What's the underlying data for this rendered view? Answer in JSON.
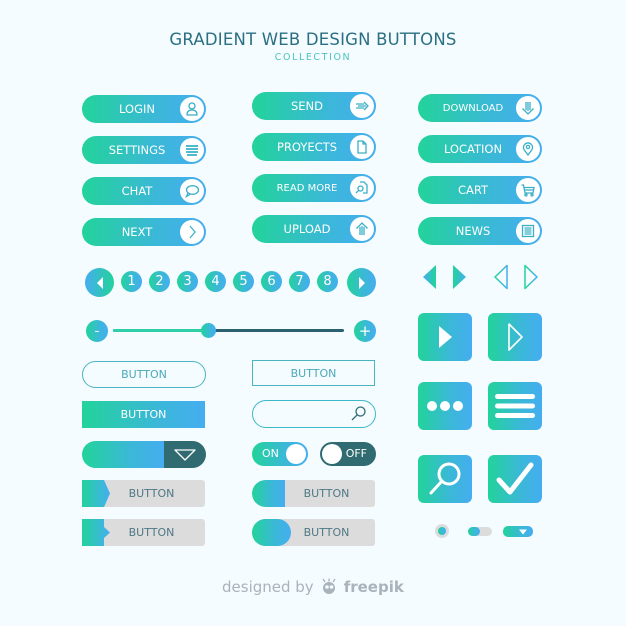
{
  "header": {
    "title": "GRADIENT WEB DESIGN BUTTONS",
    "subtitle": "COLLECTION"
  },
  "colors": {
    "background": "#f5fcff",
    "gradient_start": "#22d39a",
    "gradient_end": "#45adf0",
    "dark_teal": "#2f6b70",
    "title": "#2a6f82",
    "grey_button": "#dcdcdc"
  },
  "icon_buttons": [
    {
      "label": "LOGIN",
      "icon": "user-icon"
    },
    {
      "label": "SETTINGS",
      "icon": "menu-icon"
    },
    {
      "label": "CHAT",
      "icon": "chat-bubble-icon"
    },
    {
      "label": "NEXT",
      "icon": "chevron-right-icon"
    },
    {
      "label": "SEND",
      "icon": "send-arrow-icon"
    },
    {
      "label": "PROYECTS",
      "icon": "document-icon"
    },
    {
      "label": "READ MORE",
      "icon": "document-search-icon"
    },
    {
      "label": "UPLOAD",
      "icon": "upload-arrow-icon"
    },
    {
      "label": "DOWNLOAD",
      "icon": "download-arrow-icon"
    },
    {
      "label": "LOCATION",
      "icon": "map-pin-icon"
    },
    {
      "label": "CART",
      "icon": "cart-icon"
    },
    {
      "label": "NEWS",
      "icon": "newspaper-icon"
    }
  ],
  "pagination": {
    "pages": [
      "1",
      "2",
      "3",
      "4",
      "5",
      "6",
      "7",
      "8"
    ],
    "prev_icon": "triangle-left-icon",
    "next_icon": "triangle-right-icon"
  },
  "slider": {
    "minus_label": "-",
    "plus_label": "+",
    "value": 0.41
  },
  "buttons": {
    "outline_pill": "BUTTON",
    "outline_rect": "BUTTON",
    "filled_rect": "BUTTON",
    "search_placeholder": "",
    "grey_1": "BUTTON",
    "grey_2": "BUTTON",
    "grey_3": "BUTTON",
    "grey_4": "BUTTON"
  },
  "toggles": {
    "on_label": "ON",
    "off_label": "OFF"
  },
  "footer": {
    "designed_by": "designed by",
    "brand": "freepik"
  }
}
